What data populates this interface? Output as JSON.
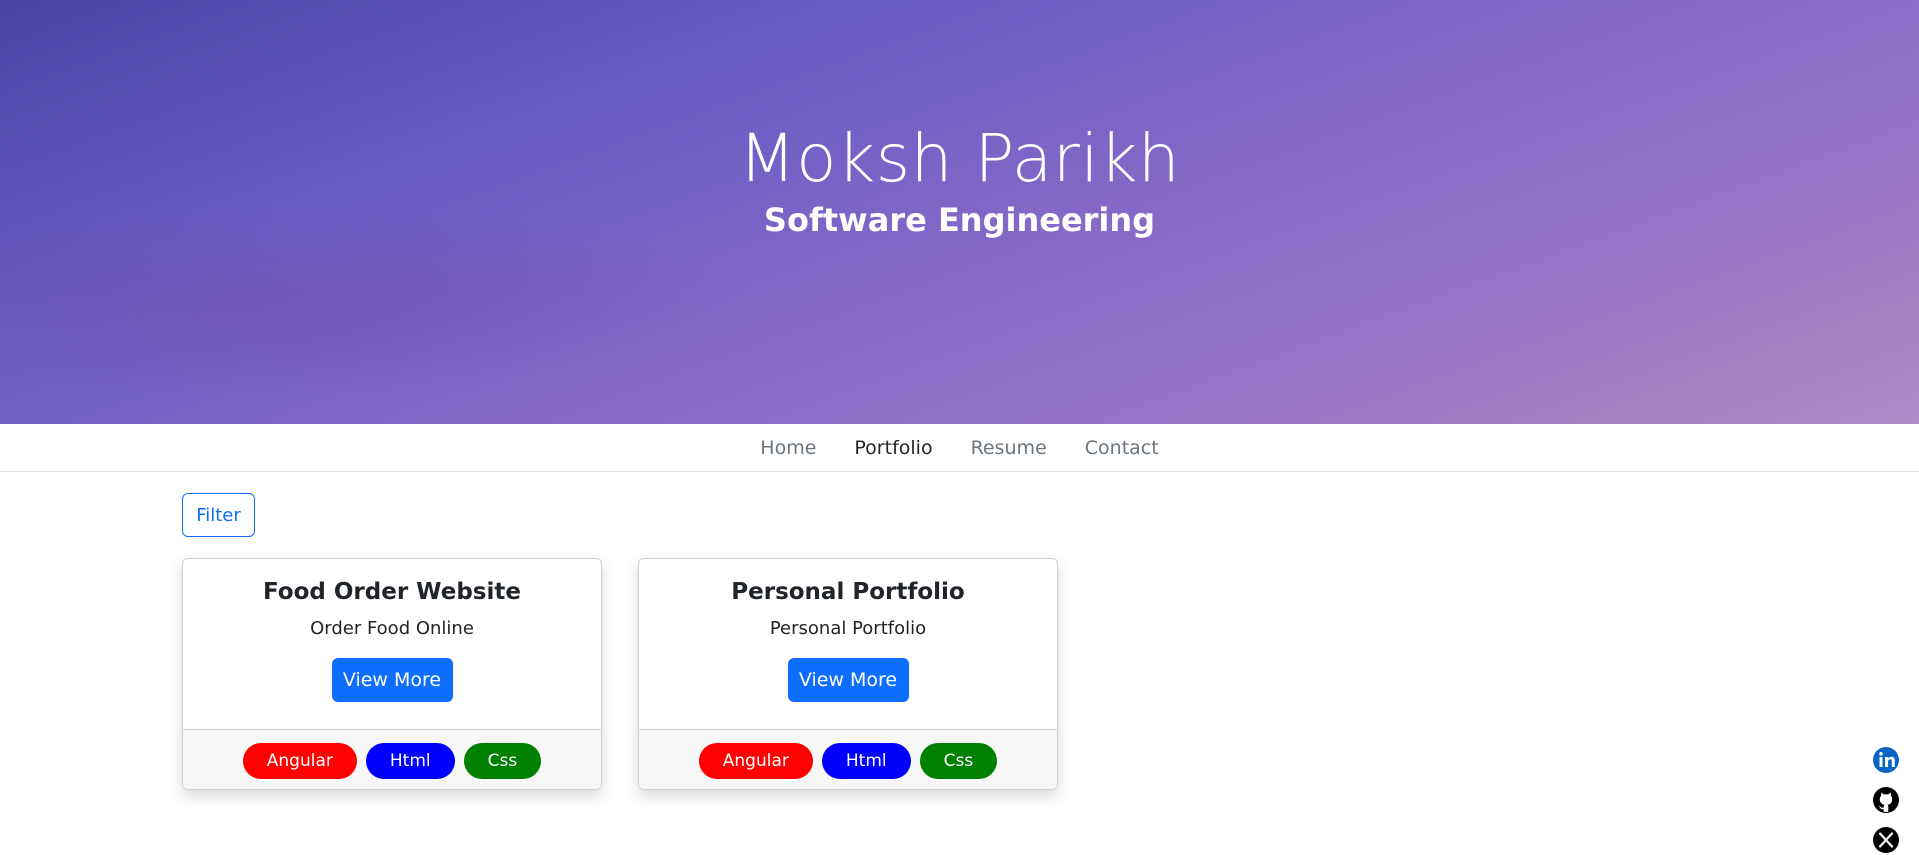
{
  "hero": {
    "name": "Moksh Parikh",
    "role": "Software Engineering"
  },
  "nav": {
    "items": [
      "Home",
      "Portfolio",
      "Resume",
      "Contact"
    ],
    "active": "Portfolio"
  },
  "filter_label": "Filter",
  "cards": [
    {
      "title": "Food Order Website",
      "subtitle": "Order Food Online",
      "button": "View More",
      "tags": [
        {
          "label": "Angular",
          "color": "#ff0000"
        },
        {
          "label": "Html",
          "color": "#0000ff"
        },
        {
          "label": "Css",
          "color": "#008000"
        }
      ]
    },
    {
      "title": "Personal Portfolio",
      "subtitle": "Personal Portfolio",
      "button": "View More",
      "tags": [
        {
          "label": "Angular",
          "color": "#ff0000"
        },
        {
          "label": "Html",
          "color": "#0000ff"
        },
        {
          "label": "Css",
          "color": "#008000"
        }
      ]
    }
  ],
  "social": [
    {
      "icon": "linkedin-icon",
      "color": "#0a66c2"
    },
    {
      "icon": "github-icon",
      "color": "#000000"
    },
    {
      "icon": "x-icon",
      "color": "#000000"
    }
  ]
}
